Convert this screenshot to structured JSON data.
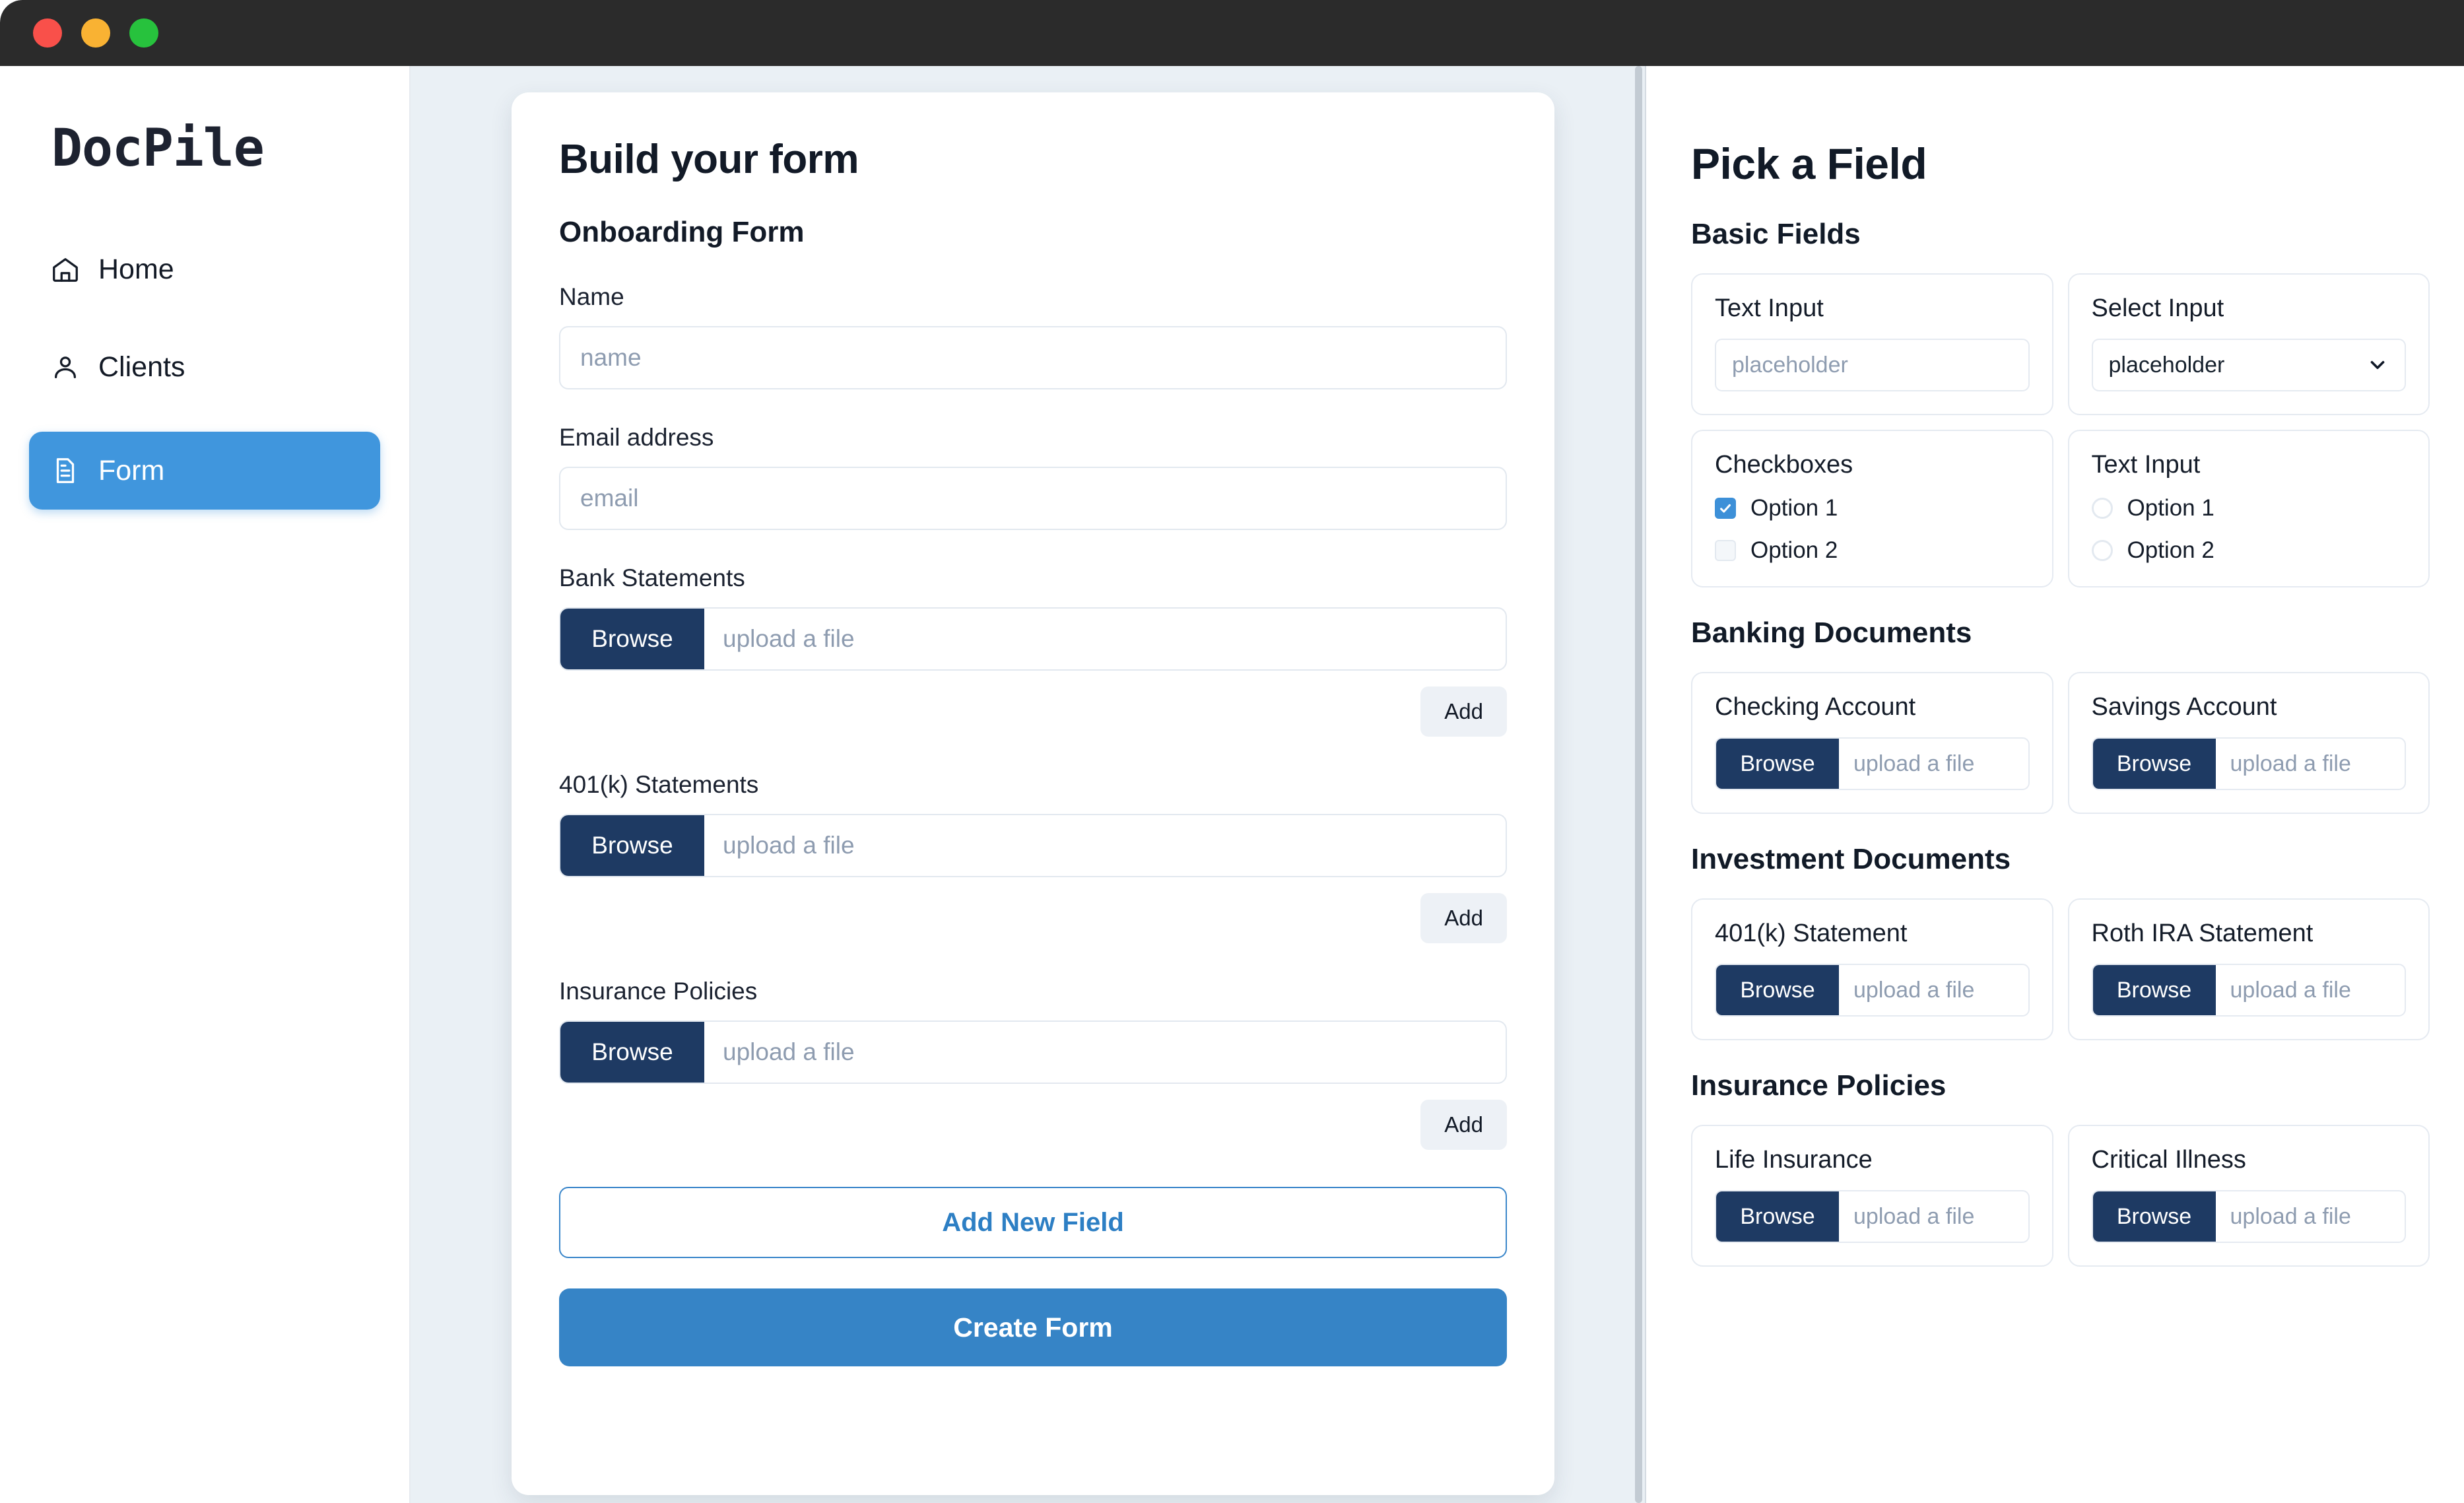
{
  "window": {
    "traffic_lights": [
      "close",
      "minimize",
      "maximize"
    ]
  },
  "sidebar": {
    "brand": "DocPile",
    "items": [
      {
        "label": "Home",
        "icon": "home-icon",
        "active": false
      },
      {
        "label": "Clients",
        "icon": "user-icon",
        "active": false
      },
      {
        "label": "Form",
        "icon": "document-icon",
        "active": true
      }
    ]
  },
  "builder": {
    "title": "Build your form",
    "form_name": "Onboarding Form",
    "fields": [
      {
        "type": "text",
        "label": "Name",
        "placeholder": "name"
      },
      {
        "type": "text",
        "label": "Email address",
        "placeholder": "email"
      },
      {
        "type": "file",
        "label": "Bank Statements",
        "browse_label": "Browse",
        "placeholder": "upload a file",
        "add_label": "Add"
      },
      {
        "type": "file",
        "label": "401(k) Statements",
        "browse_label": "Browse",
        "placeholder": "upload a file",
        "add_label": "Add"
      },
      {
        "type": "file",
        "label": "Insurance Policies",
        "browse_label": "Browse",
        "placeholder": "upload a file",
        "add_label": "Add"
      }
    ],
    "add_new_field_label": "Add New Field",
    "create_form_label": "Create Form"
  },
  "picker": {
    "title": "Pick a Field",
    "sections": [
      {
        "title": "Basic Fields",
        "cards": [
          {
            "kind": "text",
            "title": "Text Input",
            "placeholder": "placeholder"
          },
          {
            "kind": "select",
            "title": "Select Input",
            "value": "placeholder"
          },
          {
            "kind": "checkboxes",
            "title": "Checkboxes",
            "options": [
              "Option 1",
              "Option 2"
            ],
            "checked": [
              true,
              false
            ]
          },
          {
            "kind": "radios",
            "title": "Text Input",
            "options": [
              "Option 1",
              "Option 2"
            ]
          }
        ]
      },
      {
        "title": "Banking Documents",
        "cards": [
          {
            "kind": "file",
            "title": "Checking Account",
            "browse_label": "Browse",
            "placeholder": "upload a file"
          },
          {
            "kind": "file",
            "title": "Savings Account",
            "browse_label": "Browse",
            "placeholder": "upload a file"
          }
        ]
      },
      {
        "title": "Investment Documents",
        "cards": [
          {
            "kind": "file",
            "title": "401(k) Statement",
            "browse_label": "Browse",
            "placeholder": "upload a file"
          },
          {
            "kind": "file",
            "title": "Roth IRA Statement",
            "browse_label": "Browse",
            "placeholder": "upload a file"
          }
        ]
      },
      {
        "title": "Insurance Policies",
        "cards": [
          {
            "kind": "file",
            "title": "Life Insurance",
            "browse_label": "Browse",
            "placeholder": "upload a file"
          },
          {
            "kind": "file",
            "title": "Critical Illness",
            "browse_label": "Browse",
            "placeholder": "upload a file"
          }
        ]
      }
    ]
  },
  "colors": {
    "accent": "#4096dd",
    "navy": "#1e3a63",
    "titlebar": "#2b2b2b",
    "canvas": "#eaf0f5",
    "text": "#121a27",
    "muted": "#8e9cb0"
  }
}
